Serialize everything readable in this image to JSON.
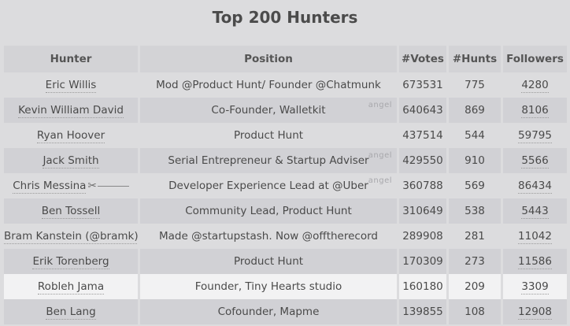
{
  "title": "Top 200 Hunters",
  "headers": {
    "hunter": "Hunter",
    "position": "Position",
    "votes": "#Votes",
    "hunts": "#Hunts",
    "followers": "Followers"
  },
  "angel_label": "angel",
  "rows": [
    {
      "hunter": "Eric Willis",
      "position": "Mod @Product Hunt/ Founder @Chatmunk",
      "votes": "673531",
      "hunts": "775",
      "followers": "4280",
      "angel": false
    },
    {
      "hunter": "Kevin William David",
      "position": "Co-Founder, Walletkit",
      "votes": "640643",
      "hunts": "869",
      "followers": "8106",
      "angel": true
    },
    {
      "hunter": "Ryan Hoover",
      "position": "Product Hunt",
      "votes": "437514",
      "hunts": "544",
      "followers": "59795",
      "angel": false
    },
    {
      "hunter": "Jack Smith",
      "position": "Serial Entrepreneur & Startup Adviser",
      "votes": "429550",
      "hunts": "910",
      "followers": "5566",
      "angel": true
    },
    {
      "hunter": "Chris Messina",
      "position": "Developer Experience Lead at @Uber",
      "votes": "360788",
      "hunts": "569",
      "followers": "86434",
      "angel": true
    },
    {
      "hunter": "Ben Tossell",
      "position": "Community Lead, Product Hunt",
      "votes": "310649",
      "hunts": "538",
      "followers": "5443",
      "angel": false
    },
    {
      "hunter": "Bram Kanstein (@bramk)",
      "position": "Made @startupstash. Now @offtherecord",
      "votes": "289908",
      "hunts": "281",
      "followers": "11042",
      "angel": false
    },
    {
      "hunter": "Erik Torenberg",
      "position": "Product Hunt",
      "votes": "170309",
      "hunts": "273",
      "followers": "11586",
      "angel": false
    },
    {
      "hunter": "Robleh Jama",
      "position": "Founder, Tiny Hearts studio",
      "votes": "160180",
      "hunts": "209",
      "followers": "3309",
      "angel": false
    },
    {
      "hunter": "Ben Lang",
      "position": "Cofounder, Mapme",
      "votes": "139855",
      "hunts": "108",
      "followers": "12908",
      "angel": false
    }
  ],
  "highlighted_row": 8
}
